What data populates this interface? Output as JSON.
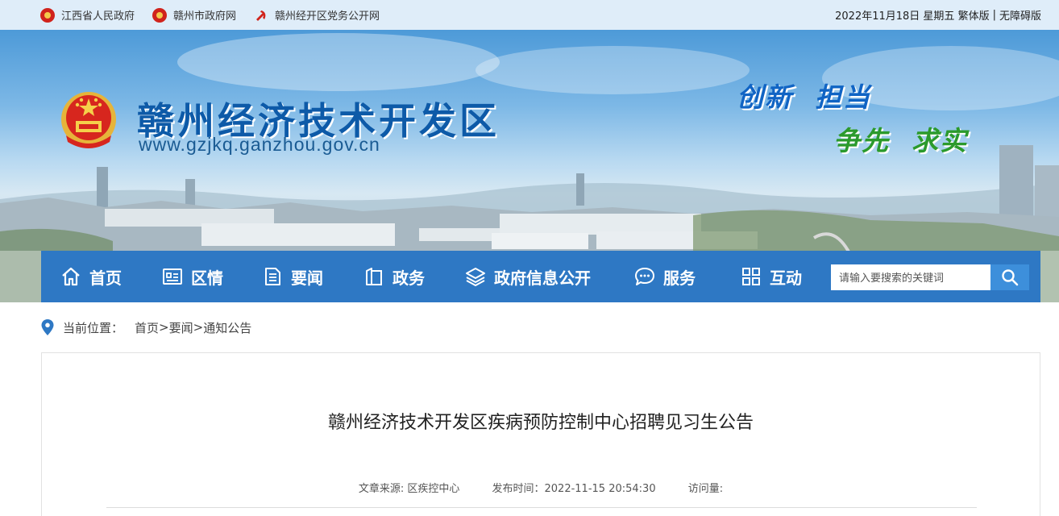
{
  "top_links": [
    {
      "label": "江西省人民政府",
      "icon": "national-emblem-icon"
    },
    {
      "label": "赣州市政府网",
      "icon": "national-emblem-icon"
    },
    {
      "label": "赣州经开区党务公开网",
      "icon": "party-emblem-icon"
    }
  ],
  "top_right": {
    "date": "2022年11月18日 星期五",
    "traditional": "繁体版",
    "separator": "|",
    "accessible": "无障碍版"
  },
  "banner": {
    "site_name": "赣州经济技术开发区",
    "site_url": "www.gzjkq.ganzhou.gov.cn",
    "slogan_line1": "创新  担当",
    "slogan_line2": "争先  求实"
  },
  "nav": {
    "items": [
      {
        "label": "首页",
        "icon": "home-icon"
      },
      {
        "label": "区情",
        "icon": "id-card-icon"
      },
      {
        "label": "要闻",
        "icon": "news-icon"
      },
      {
        "label": "政务",
        "icon": "book-icon"
      },
      {
        "label": "政府信息公开",
        "icon": "layers-icon"
      },
      {
        "label": "服务",
        "icon": "chat-icon"
      },
      {
        "label": "互动",
        "icon": "grid-icon"
      }
    ],
    "search_placeholder": "请输入要搜索的关键词"
  },
  "breadcrumb": {
    "label": "当前位置：",
    "items": [
      "首页",
      "要闻",
      "通知公告"
    ],
    "separator": ">"
  },
  "article": {
    "title": "赣州经济技术开发区疾病预防控制中心招聘见习生公告",
    "source": "文章来源: 区疾控中心",
    "published": "发布时间：2022-11-15 20:54:30",
    "views": "访问量:"
  },
  "colors": {
    "nav_bg": "#2e78c4",
    "topbar_bg": "#dfedf9",
    "brand_blue": "#0d5aa8",
    "slogan_green": "#2b9a2c"
  }
}
